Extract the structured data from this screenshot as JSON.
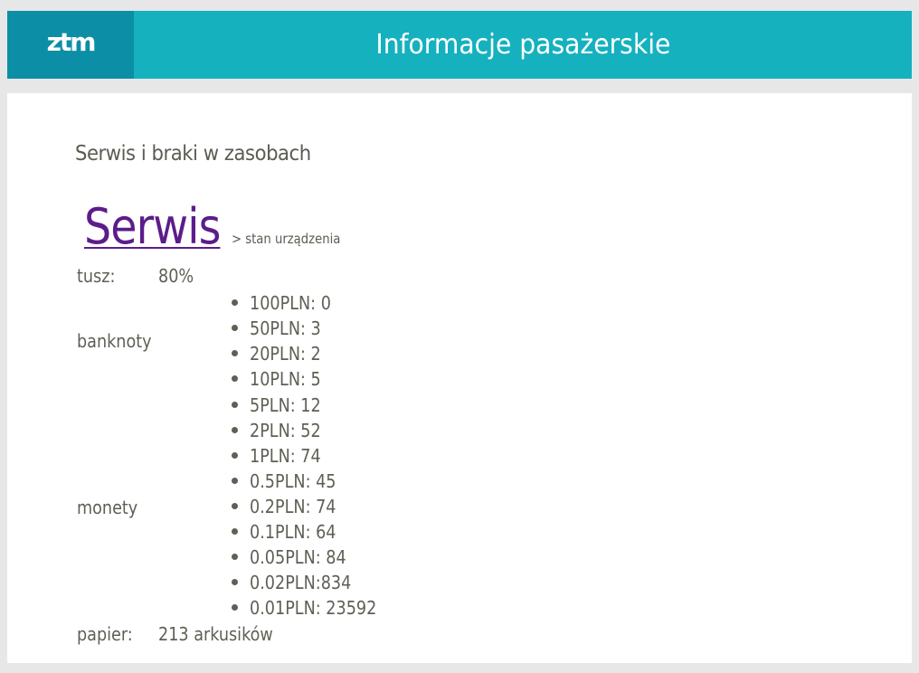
{
  "header": {
    "logo_text": "ztm",
    "title": "Informacje pasażerskie"
  },
  "main": {
    "section_title": "Serwis i braki w zasobach",
    "heading": "Serwis",
    "heading_sub": "> stan urządzenia",
    "ink": {
      "label": "tusz:",
      "value": "80%"
    },
    "banknotes": {
      "label": "banknoty",
      "items": [
        "100PLN: 0",
        "50PLN: 3",
        "20PLN: 2",
        "10PLN: 5"
      ]
    },
    "coins": {
      "label": "monety",
      "items": [
        "5PLN: 12",
        "2PLN: 52",
        "1PLN: 74",
        "0.5PLN: 45",
        "0.2PLN: 74",
        "0.1PLN: 64",
        "0.05PLN: 84",
        "0.02PLN:834",
        "0.01PLN: 23592"
      ]
    },
    "paper": {
      "label": "papier:",
      "value": "213 arkusików"
    }
  },
  "colors": {
    "header_bg": "#15b1bf",
    "logo_bg": "#0c8fa6",
    "link": "#5c1d8a",
    "text": "#5f5f55"
  }
}
